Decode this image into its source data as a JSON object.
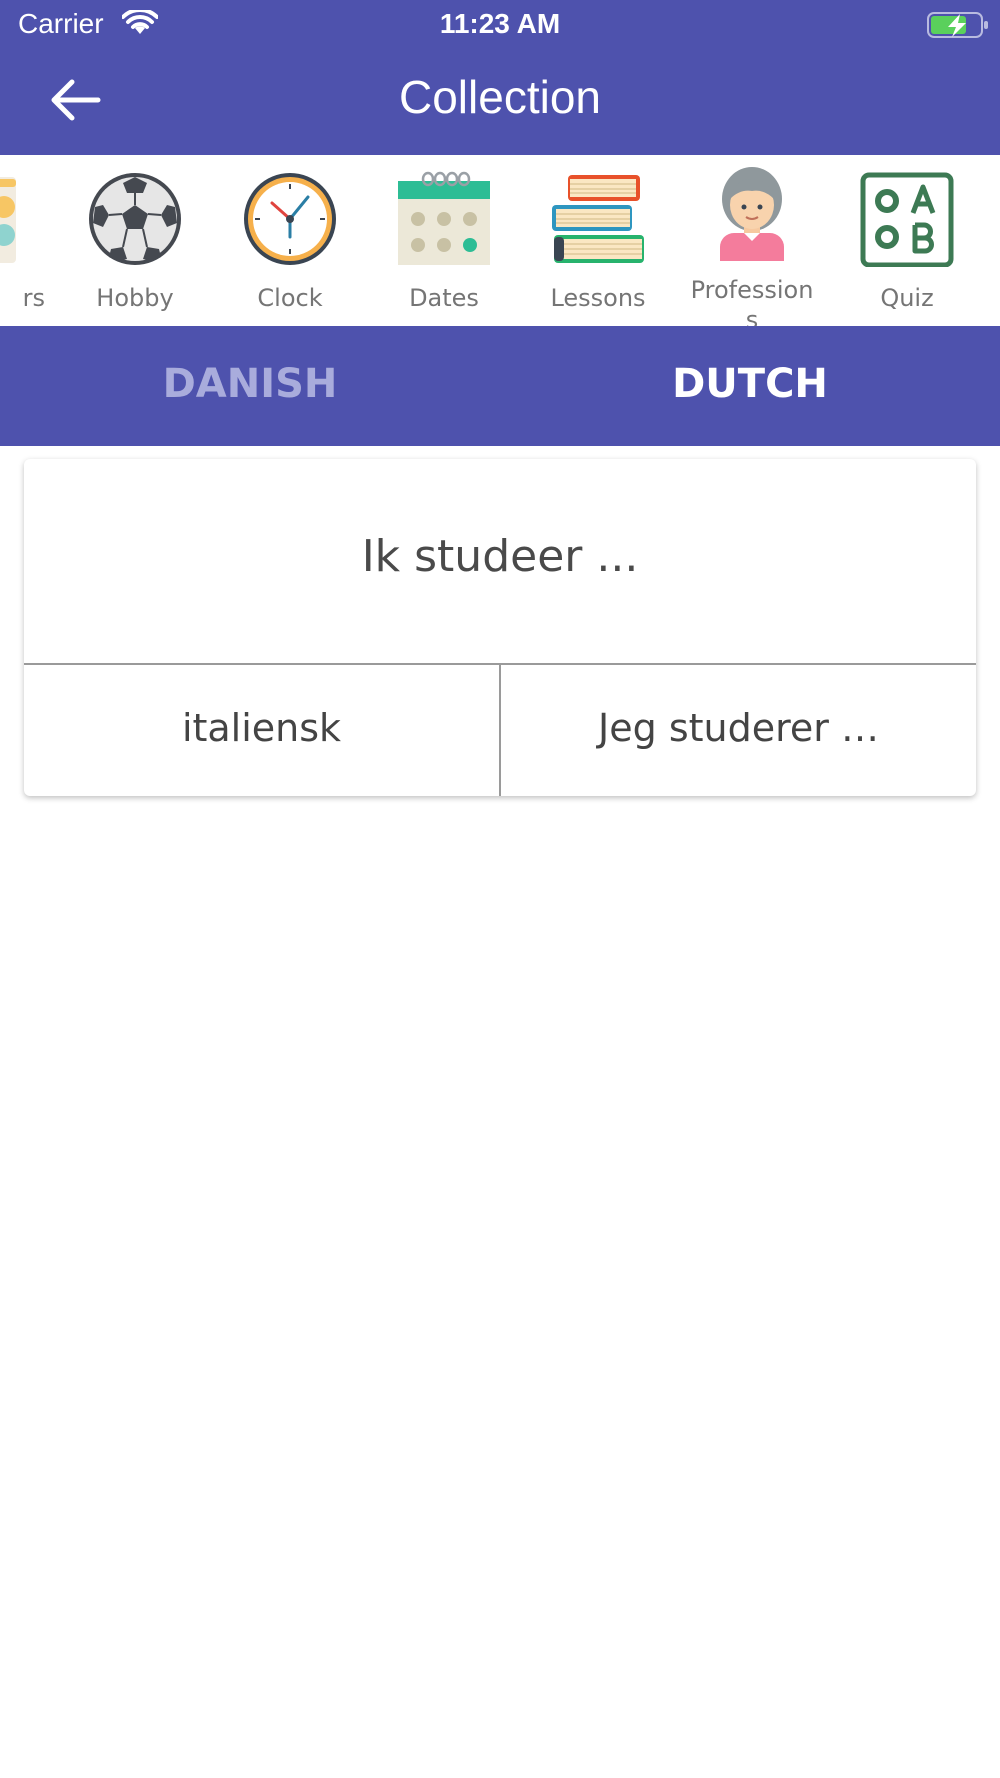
{
  "status_bar": {
    "carrier": "Carrier",
    "time": "11:23 AM"
  },
  "header": {
    "title": "Collection"
  },
  "categories": [
    {
      "label": "rs",
      "icon": "partial-category-icon"
    },
    {
      "label": "Hobby",
      "icon": "soccer-ball-icon"
    },
    {
      "label": "Clock",
      "icon": "clock-icon"
    },
    {
      "label": "Dates",
      "icon": "calendar-icon"
    },
    {
      "label": "Lessons",
      "icon": "books-icon"
    },
    {
      "label": "Profession\ns",
      "icon": "person-icon"
    },
    {
      "label": "Quiz",
      "icon": "quiz-icon"
    }
  ],
  "tabs": [
    {
      "label": "DANISH",
      "active": false
    },
    {
      "label": "DUTCH",
      "active": true
    }
  ],
  "card": {
    "question": "Ik studeer ...",
    "answers": [
      "italiensk",
      "Jeg studerer …"
    ]
  },
  "colors": {
    "primary": "#4e52ad",
    "inactive_tab": "#a9acdc"
  }
}
